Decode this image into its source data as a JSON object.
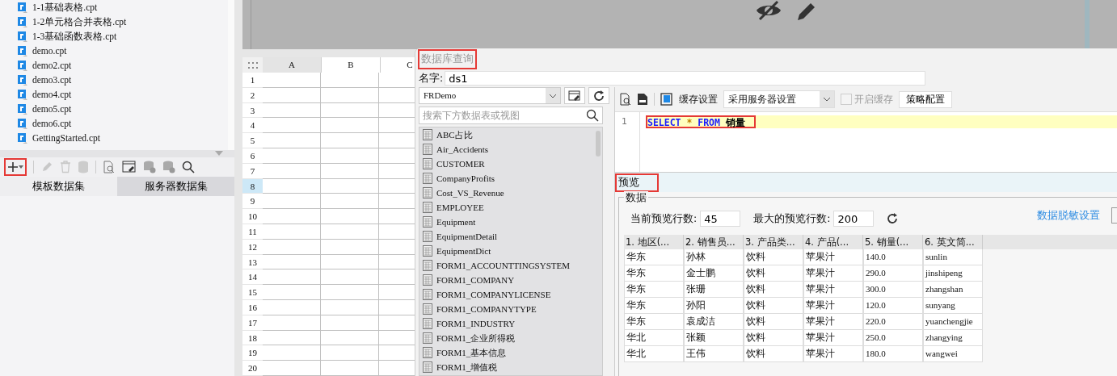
{
  "file_tree": {
    "items": [
      {
        "label": "1-1基础表格.cpt"
      },
      {
        "label": "1-2单元格合并表格.cpt"
      },
      {
        "label": "1-3基础函数表格.cpt"
      },
      {
        "label": "demo.cpt"
      },
      {
        "label": "demo2.cpt"
      },
      {
        "label": "demo3.cpt"
      },
      {
        "label": "demo4.cpt"
      },
      {
        "label": "demo5.cpt"
      },
      {
        "label": "demo6.cpt"
      },
      {
        "label": "GettingStarted.cpt"
      }
    ]
  },
  "dataset_toolbar": {
    "add_highlighted": true
  },
  "dataset_tabs": [
    {
      "label": "模板数据集",
      "selected": true
    },
    {
      "label": "服务器数据集",
      "selected": false
    }
  ],
  "sheet": {
    "columns": [
      "A",
      "B",
      "C"
    ],
    "rows": [
      {
        "label": "1",
        "selected": false
      },
      {
        "label": "2",
        "selected": false
      },
      {
        "label": "3",
        "selected": false
      },
      {
        "label": "4",
        "selected": false
      },
      {
        "label": "5",
        "selected": false
      },
      {
        "label": "6",
        "selected": false
      },
      {
        "label": "7",
        "selected": false
      },
      {
        "label": "8",
        "selected": true
      },
      {
        "label": "9",
        "selected": false
      },
      {
        "label": "10",
        "selected": false
      },
      {
        "label": "11",
        "selected": false
      },
      {
        "label": "12",
        "selected": false
      },
      {
        "label": "13",
        "selected": false
      },
      {
        "label": "14",
        "selected": false
      },
      {
        "label": "15",
        "selected": false
      },
      {
        "label": "16",
        "selected": false
      },
      {
        "label": "17",
        "selected": false
      },
      {
        "label": "18",
        "selected": false
      },
      {
        "label": "19",
        "selected": false
      },
      {
        "label": "20",
        "selected": false
      }
    ]
  },
  "dialog": {
    "title": "数据库查询",
    "title_highlighted": true,
    "name_label": "名字:",
    "name_value": "ds1",
    "connection": "FRDemo",
    "search_placeholder": "搜索下方数据表或视图",
    "tables": [
      "ABC占比",
      "Air_Accidents",
      "CUSTOMER",
      "CompanyProfits",
      "Cost_VS_Revenue",
      "EMPLOYEE",
      "Equipment",
      "EquipmentDetail",
      "EquipmentDict",
      "FORM1_ACCOUNTTINGSYSTEM",
      "FORM1_COMPANY",
      "FORM1_COMPANYLICENSE",
      "FORM1_COMPANYTYPE",
      "FORM1_INDUSTRY",
      "FORM1_企业所得税",
      "FORM1_基本信息",
      "FORM1_增值税"
    ],
    "cache_label": "缓存设置",
    "cache_mode": "采用服务器设置",
    "enable_cache": {
      "label": "开启缓存",
      "checked": false,
      "disabled": true
    },
    "strategy_button": "策略配置",
    "sql": {
      "highlighted": true,
      "lines": [
        {
          "number": "1",
          "tokens": [
            {
              "text": "SELECT",
              "kind": "keyword"
            },
            {
              "text": "*",
              "kind": "operator"
            },
            {
              "text": "FROM",
              "kind": "keyword"
            },
            {
              "text": "销量",
              "kind": "identifier"
            }
          ]
        }
      ]
    },
    "preview": {
      "title": "预览",
      "highlighted": true,
      "group": "数据",
      "current_rows_label": "当前预览行数:",
      "current_rows": "45",
      "max_rows_label": "最大的预览行数:",
      "max_rows": "200",
      "masking_link": "数据脱敏设置",
      "columns": [
        "1. 地区(...",
        "2. 销售员...",
        "3. 产品类...",
        "4. 产品(...",
        "5. 销量(...",
        "6. 英文简..."
      ],
      "rows": [
        [
          "华东",
          "孙林",
          "饮料",
          "苹果汁",
          "140.0",
          "sunlin"
        ],
        [
          "华东",
          "金士鹏",
          "饮料",
          "苹果汁",
          "290.0",
          "jinshipeng"
        ],
        [
          "华东",
          "张珊",
          "饮料",
          "苹果汁",
          "300.0",
          "zhangshan"
        ],
        [
          "华东",
          "孙阳",
          "饮料",
          "苹果汁",
          "120.0",
          "sunyang"
        ],
        [
          "华东",
          "袁成洁",
          "饮料",
          "苹果汁",
          "220.0",
          "yuanchengjie"
        ],
        [
          "华北",
          "张颖",
          "饮料",
          "苹果汁",
          "250.0",
          "zhangying"
        ],
        [
          "华北",
          "王伟",
          "饮料",
          "苹果汁",
          "180.0",
          "wangwei"
        ]
      ]
    }
  }
}
